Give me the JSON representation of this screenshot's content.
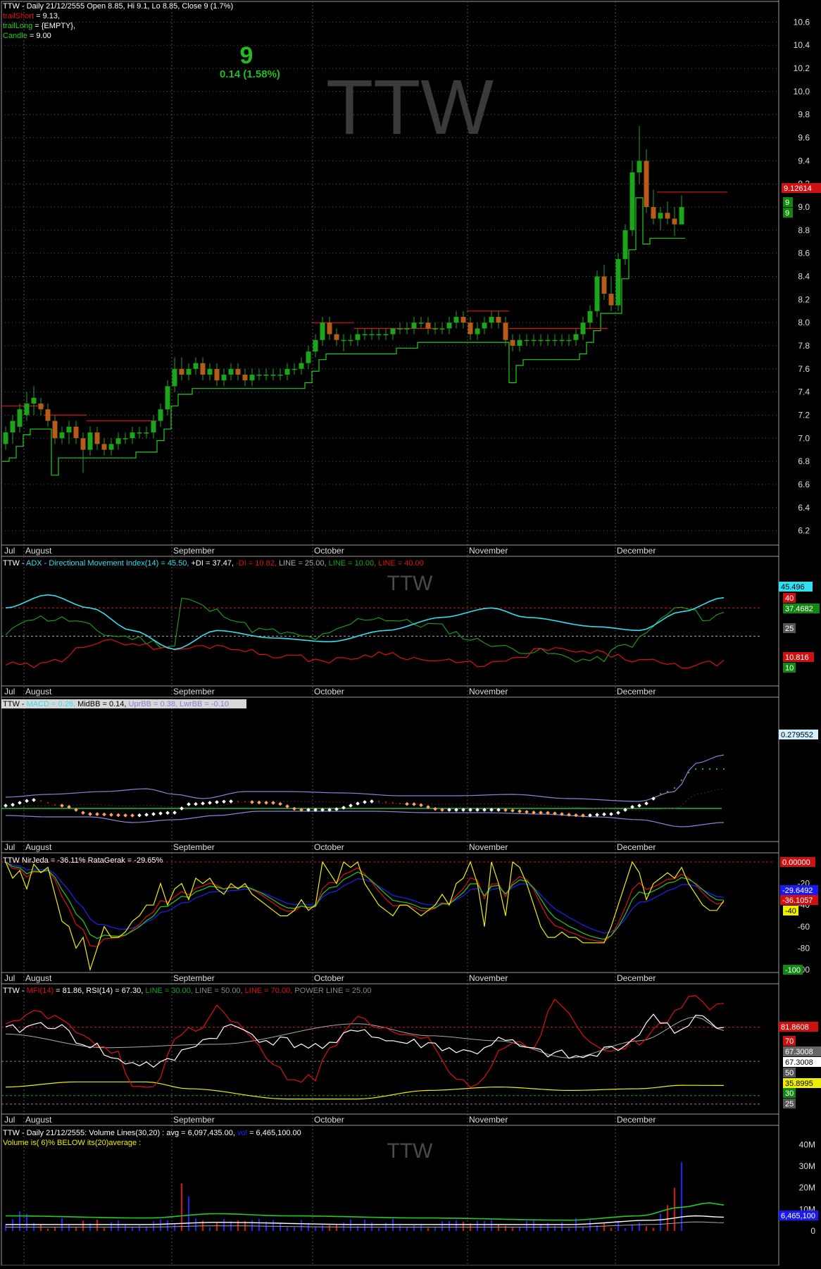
{
  "colors": {
    "bg": "#000000",
    "border": "#9a9a9a",
    "grid": "#555555",
    "up": "#1aa51a",
    "down": "#b85a1a",
    "red": "#e01010",
    "green": "#22cc22",
    "cyan": "#30e0f0",
    "blue": "#2020ff",
    "yellow": "#f0f000",
    "white": "#ffffff",
    "gray": "#808080",
    "lavender": "#8a80d8",
    "orange": "#ffa060",
    "ghost": "#3a3a3a"
  },
  "months": [
    {
      "label": "Jul",
      "day": 0
    },
    {
      "label": "August",
      "day": 3
    },
    {
      "label": "September",
      "day": 24
    },
    {
      "label": "October",
      "day": 44
    },
    {
      "label": "November",
      "day": 66
    },
    {
      "label": "December",
      "day": 87
    }
  ],
  "ghost_symbol": "TTW",
  "price_panel": {
    "header_line1": "TTW - Daily 21/12/2555 Open 8.85, Hi 9.1, Lo 8.85, Close 9 (1.7%)",
    "header_short_label": "trailShort",
    "header_short_value": " = 9.13,",
    "header_long_label": "trailLong",
    "header_long_value": " = {EMPTY},",
    "header_candle_label": "Candle",
    "header_candle_value": " = 9.00",
    "big_price": "9",
    "big_change": "0.14 (1.58%)",
    "last_trail_label": "9.12614",
    "last_price_label_1": "9",
    "last_price_label_2": "9"
  },
  "adx_panel": {
    "header_prefix": "TTW - ",
    "header_adx": "ADX - Directional Movement Index(14) = 45.50, ",
    "header_pdi": "+DI = 37.47, ",
    "header_mdi": "-DI = 10.82, ",
    "header_line25": "LINE = 25.00, ",
    "header_line10": "LINE = 10.00, ",
    "header_line40": "LINE = 40.00",
    "labels": {
      "adx": "45.496",
      "line40": "40",
      "pdi": "37.4682",
      "line25": "25",
      "mdi": "10.816",
      "line10": "10"
    }
  },
  "macd_panel": {
    "header_ttw": "TTW - ",
    "header_macd": "MACD = 0.28, ",
    "header_mid": "MidBB = 0.14, ",
    "header_upr": "UprBB = 0.38, ",
    "header_lwr": "LwrBB = -0.10",
    "label": "0.279552"
  },
  "stoch_panel": {
    "header_ttw": "TTW",
    "header_nirjeda": "NirJeda =  -36.11%",
    "header_ratagerak": "RataGerak =  -29.65%",
    "labels": {
      "top": "0.00000",
      "blue": "-29.6492",
      "red": "-36.1057",
      "y40": "-40",
      "bottom": "-100"
    }
  },
  "mfi_panel": {
    "header_ttw": "TTW - ",
    "header_mfi": "MFI(14)",
    "header_mfi_val": " = 81.86, ",
    "header_rsi": "RSI(14)",
    "header_rsi_val": " = 67.30, ",
    "header_l30": "LINE = 30.00, ",
    "header_l50": "LINE = 50.00, ",
    "header_l70": "LINE = 70.00, ",
    "header_power": "POWER LINE = 25.00",
    "labels": {
      "mfi": "81.8608",
      "l70": "70",
      "rsi1": "67.3008",
      "rsi2": "67.3008",
      "l50": "50",
      "yel": "35.8995",
      "l30": "30",
      "l25": "25"
    }
  },
  "volume_panel": {
    "header_line1_a": "TTW - Daily 21/12/2555: Volume Lines(30,20) : avg = 6,097,435.00, ",
    "header_line1_b": "vol",
    "header_line1_c": " = 6,465,100.00",
    "header_line2": "Volume is( 6)% BELOW its(20)average :",
    "last_label": "6,465,100"
  },
  "chart_data": [
    {
      "type": "candlestick",
      "title": "TTW - Daily 21/12/2555",
      "ylim": [
        6.1,
        10.7
      ],
      "yticks": [
        "6.2",
        "6.4",
        "6.6",
        "6.8",
        "7.0",
        "7.2",
        "7.4",
        "7.6",
        "7.8",
        "8.0",
        "8.2",
        "8.4",
        "8.6",
        "8.8",
        "9.0",
        "9.2",
        "9.4",
        "9.6",
        "9.8",
        "10.0",
        "10.2",
        "10.4",
        "10.6"
      ],
      "series": [
        {
          "name": "Candle",
          "close_last": 9.0
        },
        {
          "name": "trailShort",
          "last": 9.13
        },
        {
          "name": "trailLong",
          "last": null
        }
      ],
      "ohlc": [
        [
          6.95,
          7.1,
          6.9,
          7.05
        ],
        [
          7.05,
          7.2,
          6.95,
          7.15
        ],
        [
          7.1,
          7.3,
          7.05,
          7.25
        ],
        [
          7.2,
          7.4,
          7.15,
          7.3
        ],
        [
          7.3,
          7.45,
          7.2,
          7.35
        ],
        [
          7.3,
          7.35,
          7.2,
          7.25
        ],
        [
          7.25,
          7.3,
          7.1,
          7.15
        ],
        [
          7.15,
          7.2,
          6.95,
          7.0
        ],
        [
          7.0,
          7.1,
          6.95,
          7.05
        ],
        [
          7.05,
          7.15,
          6.95,
          7.1
        ],
        [
          7.1,
          7.15,
          6.95,
          7.0
        ],
        [
          7.0,
          7.05,
          6.7,
          6.9
        ],
        [
          6.9,
          7.1,
          6.85,
          7.05
        ],
        [
          7.05,
          7.1,
          6.9,
          6.95
        ],
        [
          6.95,
          7.0,
          6.85,
          6.9
        ],
        [
          6.9,
          7.0,
          6.85,
          6.95
        ],
        [
          6.95,
          7.05,
          6.9,
          7.0
        ],
        [
          7.0,
          7.05,
          6.95,
          7.0
        ],
        [
          7.0,
          7.1,
          6.95,
          7.05
        ],
        [
          7.05,
          7.1,
          7.0,
          7.05
        ],
        [
          7.05,
          7.1,
          7.0,
          7.05
        ],
        [
          7.05,
          7.2,
          7.0,
          7.15
        ],
        [
          7.15,
          7.3,
          7.1,
          7.25
        ],
        [
          7.25,
          7.5,
          7.2,
          7.45
        ],
        [
          7.45,
          7.7,
          7.4,
          7.6
        ],
        [
          7.6,
          7.7,
          7.5,
          7.55
        ],
        [
          7.55,
          7.65,
          7.5,
          7.6
        ],
        [
          7.6,
          7.7,
          7.55,
          7.65
        ],
        [
          7.65,
          7.7,
          7.5,
          7.55
        ],
        [
          7.55,
          7.65,
          7.5,
          7.6
        ],
        [
          7.6,
          7.65,
          7.45,
          7.5
        ],
        [
          7.5,
          7.6,
          7.45,
          7.55
        ],
        [
          7.55,
          7.65,
          7.5,
          7.6
        ],
        [
          7.6,
          7.65,
          7.5,
          7.55
        ],
        [
          7.55,
          7.6,
          7.45,
          7.5
        ],
        [
          7.5,
          7.6,
          7.45,
          7.55
        ],
        [
          7.55,
          7.6,
          7.5,
          7.55
        ],
        [
          7.55,
          7.6,
          7.5,
          7.55
        ],
        [
          7.55,
          7.6,
          7.5,
          7.55
        ],
        [
          7.55,
          7.6,
          7.5,
          7.55
        ],
        [
          7.55,
          7.65,
          7.5,
          7.6
        ],
        [
          7.6,
          7.65,
          7.55,
          7.6
        ],
        [
          7.6,
          7.7,
          7.55,
          7.65
        ],
        [
          7.65,
          7.8,
          7.6,
          7.75
        ],
        [
          7.75,
          7.9,
          7.7,
          7.85
        ],
        [
          7.85,
          8.05,
          7.8,
          8.0
        ],
        [
          8.0,
          8.05,
          7.85,
          7.9
        ],
        [
          7.9,
          7.95,
          7.8,
          7.85
        ],
        [
          7.85,
          7.9,
          7.75,
          7.85
        ],
        [
          7.85,
          7.9,
          7.8,
          7.85
        ],
        [
          7.85,
          7.95,
          7.8,
          7.9
        ],
        [
          7.9,
          7.95,
          7.85,
          7.9
        ],
        [
          7.9,
          7.95,
          7.85,
          7.9
        ],
        [
          7.9,
          7.95,
          7.85,
          7.9
        ],
        [
          7.9,
          7.95,
          7.85,
          7.9
        ],
        [
          7.9,
          7.95,
          7.85,
          7.95
        ],
        [
          7.95,
          8.0,
          7.9,
          7.95
        ],
        [
          7.95,
          8.0,
          7.9,
          7.95
        ],
        [
          7.95,
          8.05,
          7.9,
          8.0
        ],
        [
          8.0,
          8.05,
          7.95,
          8.0
        ],
        [
          8.0,
          8.05,
          7.9,
          7.95
        ],
        [
          7.95,
          8.0,
          7.9,
          7.95
        ],
        [
          7.95,
          8.0,
          7.9,
          7.95
        ],
        [
          7.95,
          8.05,
          7.9,
          8.0
        ],
        [
          8.0,
          8.1,
          7.95,
          8.05
        ],
        [
          8.05,
          8.1,
          7.95,
          8.0
        ],
        [
          8.0,
          8.05,
          7.85,
          7.9
        ],
        [
          7.9,
          8.0,
          7.85,
          7.95
        ],
        [
          7.95,
          8.05,
          7.9,
          8.0
        ],
        [
          8.0,
          8.1,
          7.95,
          8.05
        ],
        [
          8.05,
          8.1,
          7.95,
          8.0
        ],
        [
          8.0,
          8.05,
          7.8,
          7.85
        ],
        [
          7.85,
          7.9,
          7.75,
          7.8
        ],
        [
          7.8,
          7.9,
          7.75,
          7.85
        ],
        [
          7.85,
          7.9,
          7.8,
          7.85
        ],
        [
          7.85,
          7.9,
          7.8,
          7.85
        ],
        [
          7.85,
          7.9,
          7.8,
          7.85
        ],
        [
          7.85,
          7.9,
          7.8,
          7.85
        ],
        [
          7.85,
          7.9,
          7.8,
          7.85
        ],
        [
          7.85,
          7.9,
          7.8,
          7.85
        ],
        [
          7.85,
          7.9,
          7.8,
          7.85
        ],
        [
          7.85,
          7.95,
          7.8,
          7.9
        ],
        [
          7.9,
          8.05,
          7.85,
          8.0
        ],
        [
          8.0,
          8.15,
          7.95,
          8.1
        ],
        [
          8.1,
          8.45,
          8.05,
          8.4
        ],
        [
          8.4,
          8.5,
          8.2,
          8.25
        ],
        [
          8.25,
          8.4,
          8.1,
          8.15
        ],
        [
          8.15,
          8.6,
          8.1,
          8.55
        ],
        [
          8.55,
          8.85,
          8.5,
          8.8
        ],
        [
          8.8,
          9.4,
          8.75,
          9.3
        ],
        [
          9.3,
          9.7,
          9.2,
          9.4
        ],
        [
          9.4,
          9.5,
          8.95,
          9.0
        ],
        [
          9.0,
          9.15,
          8.85,
          8.9
        ],
        [
          8.9,
          9.0,
          8.8,
          8.95
        ],
        [
          8.95,
          9.05,
          8.85,
          8.9
        ],
        [
          8.9,
          9.0,
          8.75,
          8.85
        ],
        [
          8.85,
          9.1,
          8.85,
          9.0
        ]
      ]
    },
    {
      "type": "line",
      "title": "ADX - Directional Movement Index(14)",
      "ylim": [
        0,
        60
      ],
      "series": [
        {
          "name": "ADX",
          "last": 45.5
        },
        {
          "name": "+DI",
          "last": 37.47
        },
        {
          "name": "-DI",
          "last": 10.82
        },
        {
          "name": "LINE",
          "values": [
            25
          ]
        },
        {
          "name": "LINE",
          "values": [
            10
          ]
        },
        {
          "name": "LINE",
          "values": [
            40
          ]
        }
      ]
    },
    {
      "type": "line",
      "title": "MACD",
      "series": [
        {
          "name": "MACD",
          "last": 0.28
        },
        {
          "name": "MidBB",
          "last": 0.14
        },
        {
          "name": "UprBB",
          "last": 0.38
        },
        {
          "name": "LwrBB",
          "last": -0.1
        }
      ]
    },
    {
      "type": "line",
      "ylim": [
        -100,
        0
      ],
      "yticks": [
        "-20",
        "-40",
        "-60",
        "-80",
        "-100"
      ],
      "series": [
        {
          "name": "NirJeda",
          "last": -36.11
        },
        {
          "name": "RataGerak",
          "last": -29.65
        }
      ]
    },
    {
      "type": "line",
      "ylim": [
        20,
        90
      ],
      "series": [
        {
          "name": "MFI(14)",
          "last": 81.86
        },
        {
          "name": "RSI(14)",
          "last": 67.3
        },
        {
          "name": "LINE",
          "values": [
            30
          ]
        },
        {
          "name": "LINE",
          "values": [
            50
          ]
        },
        {
          "name": "LINE",
          "values": [
            70
          ]
        },
        {
          "name": "POWER LINE",
          "values": [
            25
          ]
        }
      ]
    },
    {
      "type": "bar",
      "title": "Volume Lines(30,20)",
      "ylim": [
        0,
        45
      ],
      "yticks": [
        "0",
        "10M",
        "20M",
        "30M",
        "40M"
      ],
      "series": [
        {
          "name": "avg",
          "last": 6097435
        },
        {
          "name": "vol",
          "last": 6465100
        }
      ]
    }
  ]
}
